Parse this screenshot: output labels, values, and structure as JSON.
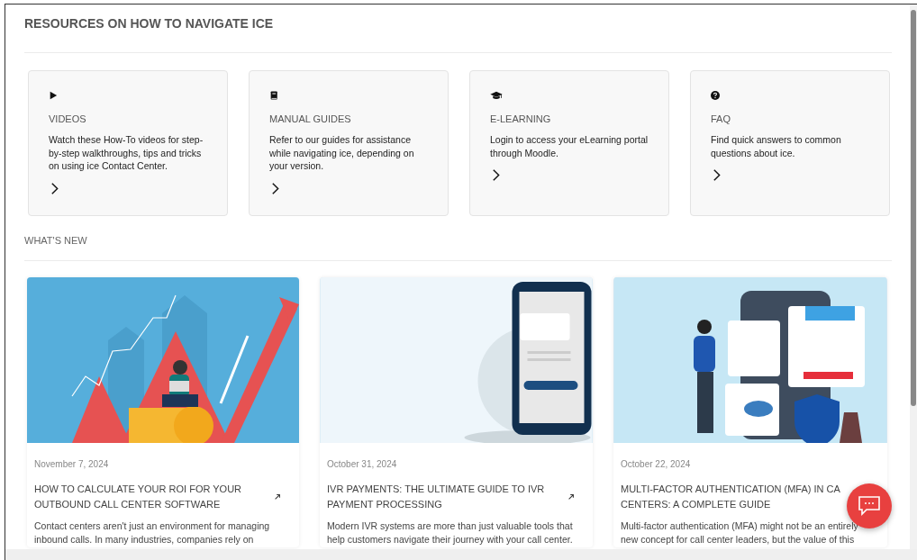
{
  "section_title": "RESOURCES ON HOW TO NAVIGATE ICE",
  "resources": [
    {
      "kind": "video",
      "title": "VIDEOS",
      "description": "Watch these How-To videos for step-by-step walkthroughs, tips and tricks on using ice Contact Center."
    },
    {
      "kind": "manual",
      "title": "MANUAL GUIDES",
      "description": "Refer to our guides for assistance while navigating ice, depending on your version."
    },
    {
      "kind": "elearning",
      "title": "E-LEARNING",
      "description": "Login to access your eLearning portal through Moodle."
    },
    {
      "kind": "faq",
      "title": "FAQ",
      "description": "Find quick answers to common questions about ice."
    }
  ],
  "whats_new": {
    "heading": "WHAT'S NEW",
    "articles": [
      {
        "kind": "growth",
        "date": "November 7, 2024",
        "title_lines": [
          "HOW TO CALCULATE YOUR ROI FOR YOUR",
          "OUTBOUND CALL CENTER SOFTWARE"
        ],
        "excerpt_lines": [
          "Contact centers aren't just an environment for managing",
          "inbound calls. In many industries, companies rely on"
        ]
      },
      {
        "kind": "payment",
        "date": "October 31, 2024",
        "title_lines": [
          "IVR PAYMENTS: THE ULTIMATE GUIDE TO IVR",
          "PAYMENT PROCESSING"
        ],
        "excerpt_lines": [
          "Modern IVR systems are more than just valuable tools that",
          "help customers navigate their journey with your call center."
        ]
      },
      {
        "kind": "security",
        "date": "October 22, 2024",
        "title_lines": [
          "MULTI-FACTOR AUTHENTICATION (MFA) IN CA",
          "CENTERS: A COMPLETE GUIDE"
        ],
        "excerpt_lines": [
          "Multi-factor authentication (MFA) might not be an entirely",
          "new concept for call center leaders, but the value of this"
        ]
      }
    ]
  }
}
